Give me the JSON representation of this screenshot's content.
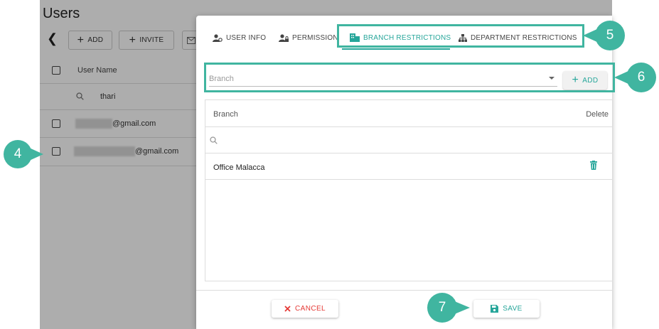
{
  "background": {
    "title": "Users",
    "toolbar": {
      "add_label": "ADD",
      "invite_label": "INVITE"
    },
    "table": {
      "header": "User Name",
      "search_value": "thari",
      "rows": [
        "@gmail.com",
        "@gmail.com"
      ]
    }
  },
  "dialog": {
    "tabs": [
      {
        "label": "USER INFO",
        "icon": "user-cog-icon"
      },
      {
        "label": "PERMISSION",
        "icon": "user-lock-icon"
      },
      {
        "label": "BRANCH RESTRICTIONS",
        "icon": "building-icon",
        "active": true
      },
      {
        "label": "DEPARTMENT RESTRICTIONS",
        "icon": "org-chart-icon"
      }
    ],
    "branch_placeholder": "Branch",
    "add_label": "ADD",
    "table": {
      "columns": [
        "Branch",
        "Delete"
      ],
      "rows": [
        {
          "branch": "Office Malacca"
        }
      ]
    },
    "cancel_label": "CANCEL",
    "save_label": "SAVE"
  },
  "callouts": [
    "4",
    "5",
    "6",
    "7"
  ],
  "colors": {
    "accent": "#26a69a",
    "callout": "#40b5a0",
    "danger": "#e53935"
  }
}
